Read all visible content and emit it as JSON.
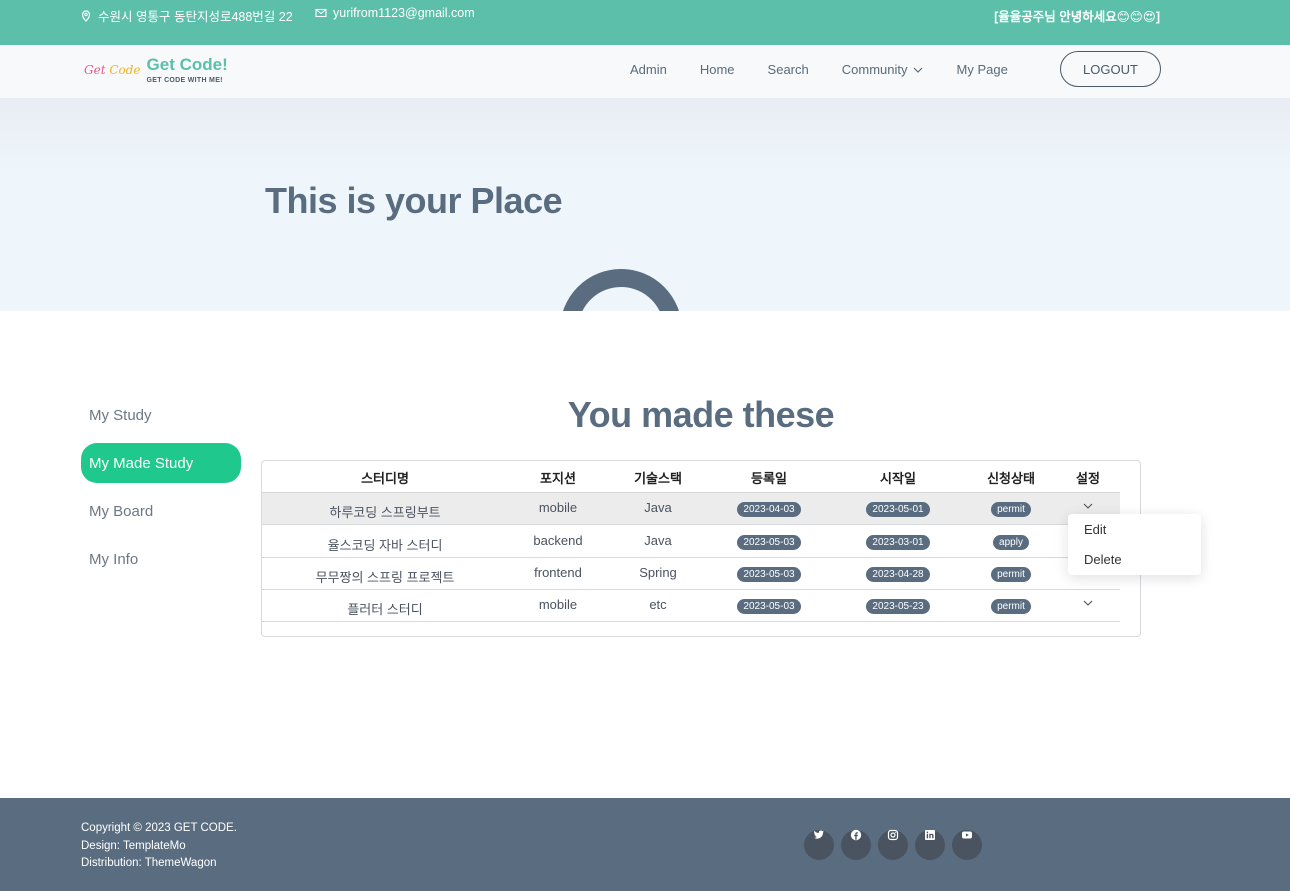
{
  "topbar": {
    "address": "수원시 영통구 동탄지성로488번길 22",
    "email": "yurifrom1123@gmail.com",
    "greeting": "[율율공주님 안녕하세요😊😊😍]"
  },
  "nav": {
    "logo_mark_g": "Get ",
    "logo_mark_c": "Code",
    "logo_title": "Get Code!",
    "logo_sub": "GET CODE WITH ME!",
    "items": [
      {
        "label": "Admin"
      },
      {
        "label": "Home"
      },
      {
        "label": "Search"
      },
      {
        "label": "Community"
      },
      {
        "label": "My Page"
      }
    ],
    "logout_label": "LOGOUT"
  },
  "hero": {
    "title": "This is your Place"
  },
  "sidebar": {
    "items": [
      {
        "label": "My Study"
      },
      {
        "label": "My Made Study"
      },
      {
        "label": "My Board"
      },
      {
        "label": "My Info"
      }
    ],
    "active_index": 1
  },
  "section": {
    "title": "You made these"
  },
  "table": {
    "headers": [
      "스터디명",
      "포지션",
      "기술스택",
      "등록일",
      "시작일",
      "신청상태",
      "설정"
    ],
    "rows": [
      {
        "name": "하루코딩 스프링부트",
        "position": "mobile",
        "stack": "Java",
        "registered": "2023-04-03",
        "start": "2023-05-01",
        "status": "permit"
      },
      {
        "name": "율스코딩 자바 스터디",
        "position": "backend",
        "stack": "Java",
        "registered": "2023-05-03",
        "start": "2023-03-01",
        "status": "apply"
      },
      {
        "name": "무무짱의 스프링 프로젝트",
        "position": "frontend",
        "stack": "Spring",
        "registered": "2023-05-03",
        "start": "2023-04-28",
        "status": "permit"
      },
      {
        "name": "플러터 스터디",
        "position": "mobile",
        "stack": "etc",
        "registered": "2023-05-03",
        "start": "2023-05-23",
        "status": "permit"
      }
    ]
  },
  "dropdown": {
    "edit": "Edit",
    "delete": "Delete"
  },
  "footer": {
    "copyright": "Copyright © 2023 GET CODE.",
    "design": "Design: TemplateMo",
    "distribution": "Distribution: ThemeWagon",
    "social": [
      "twitter-icon",
      "facebook-icon",
      "instagram-icon",
      "linkedin-icon",
      "youtube-icon"
    ]
  },
  "colors": {
    "topbar": "#5bbfa9",
    "accent_active": "#1fc98d",
    "heading": "#5a6d80",
    "footer": "#5a6d80"
  }
}
